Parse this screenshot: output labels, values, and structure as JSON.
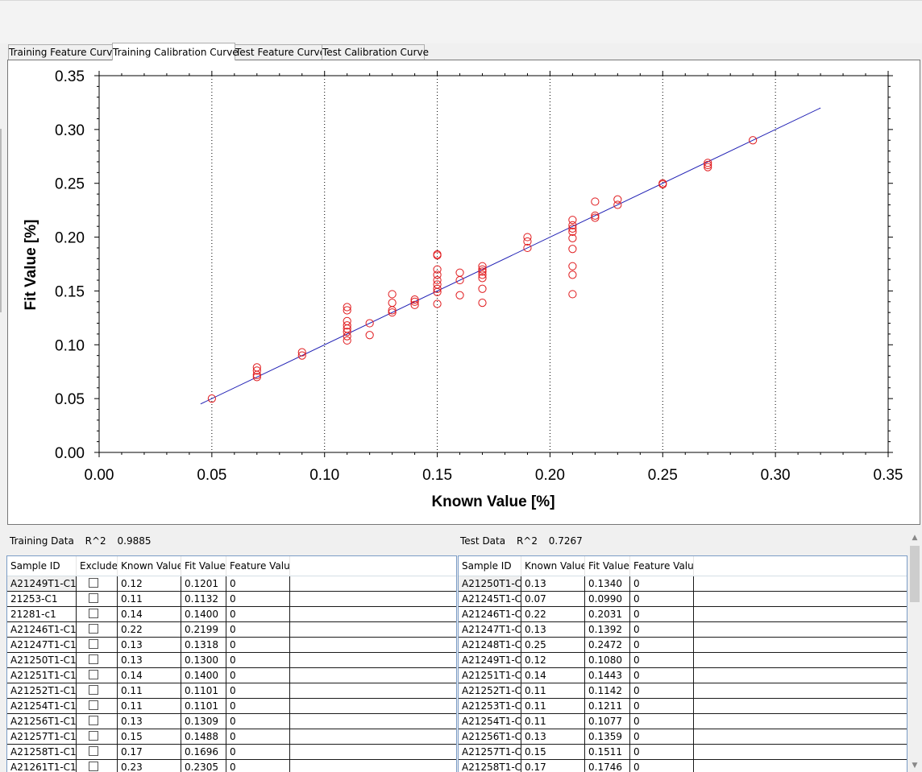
{
  "tabs": [
    "Training Feature Curve",
    "Training Calibration Curve",
    "Test Feature Curve",
    "Test Calibration Curve"
  ],
  "active_tab": 1,
  "chart_data": {
    "type": "scatter",
    "title": "",
    "xlabel": "Known Value [%]",
    "ylabel": "Fit Value [%]",
    "xlim": [
      0,
      0.35
    ],
    "ylim": [
      0,
      0.35
    ],
    "x_ticks": [
      "0.00",
      "0.05",
      "0.10",
      "0.15",
      "0.20",
      "0.25",
      "0.30",
      "0.35"
    ],
    "y_ticks": [
      "0.00",
      "0.05",
      "0.10",
      "0.15",
      "0.20",
      "0.25",
      "0.30",
      "0.35"
    ],
    "x_gridlines": "dotted vertical",
    "marker_color": "#e0191c",
    "line_color": "#1f1fb4",
    "fit_line": {
      "x": [
        0.045,
        0.32
      ],
      "y": [
        0.045,
        0.32
      ]
    },
    "points": [
      [
        0.05,
        0.05
      ],
      [
        0.07,
        0.07
      ],
      [
        0.07,
        0.072
      ],
      [
        0.07,
        0.076
      ],
      [
        0.07,
        0.079
      ],
      [
        0.09,
        0.09
      ],
      [
        0.09,
        0.093
      ],
      [
        0.11,
        0.104
      ],
      [
        0.11,
        0.108
      ],
      [
        0.11,
        0.112
      ],
      [
        0.11,
        0.115
      ],
      [
        0.11,
        0.118
      ],
      [
        0.11,
        0.122
      ],
      [
        0.11,
        0.132
      ],
      [
        0.11,
        0.135
      ],
      [
        0.12,
        0.109
      ],
      [
        0.12,
        0.12
      ],
      [
        0.13,
        0.13
      ],
      [
        0.13,
        0.132
      ],
      [
        0.13,
        0.139
      ],
      [
        0.13,
        0.147
      ],
      [
        0.14,
        0.137
      ],
      [
        0.14,
        0.14
      ],
      [
        0.14,
        0.142
      ],
      [
        0.15,
        0.138
      ],
      [
        0.15,
        0.149
      ],
      [
        0.15,
        0.152
      ],
      [
        0.15,
        0.156
      ],
      [
        0.15,
        0.16
      ],
      [
        0.15,
        0.165
      ],
      [
        0.15,
        0.17
      ],
      [
        0.15,
        0.183
      ],
      [
        0.15,
        0.184
      ],
      [
        0.16,
        0.146
      ],
      [
        0.16,
        0.16
      ],
      [
        0.16,
        0.167
      ],
      [
        0.17,
        0.139
      ],
      [
        0.17,
        0.152
      ],
      [
        0.17,
        0.162
      ],
      [
        0.17,
        0.165
      ],
      [
        0.17,
        0.168
      ],
      [
        0.17,
        0.17
      ],
      [
        0.17,
        0.173
      ],
      [
        0.19,
        0.19
      ],
      [
        0.19,
        0.196
      ],
      [
        0.19,
        0.2
      ],
      [
        0.21,
        0.147
      ],
      [
        0.21,
        0.165
      ],
      [
        0.21,
        0.173
      ],
      [
        0.21,
        0.189
      ],
      [
        0.21,
        0.199
      ],
      [
        0.21,
        0.205
      ],
      [
        0.21,
        0.208
      ],
      [
        0.21,
        0.211
      ],
      [
        0.21,
        0.216
      ],
      [
        0.22,
        0.218
      ],
      [
        0.22,
        0.22
      ],
      [
        0.22,
        0.233
      ],
      [
        0.23,
        0.23
      ],
      [
        0.23,
        0.235
      ],
      [
        0.25,
        0.249
      ],
      [
        0.25,
        0.25
      ],
      [
        0.27,
        0.265
      ],
      [
        0.27,
        0.267
      ],
      [
        0.27,
        0.269
      ],
      [
        0.29,
        0.29
      ]
    ]
  },
  "training": {
    "label": "Training Data",
    "r2_label": "R^2",
    "r2_value": "0.9885",
    "columns": [
      "Sample ID",
      "Exclude",
      "Known Value",
      "Fit Value",
      "Feature Value"
    ],
    "rows": [
      [
        "A21249T1-C1",
        "",
        "0.12",
        "0.1201",
        "0"
      ],
      [
        "21253-C1",
        "",
        "0.11",
        "0.1132",
        "0"
      ],
      [
        "21281-c1",
        "",
        "0.14",
        "0.1400",
        "0"
      ],
      [
        "A21246T1-C1",
        "",
        "0.22",
        "0.2199",
        "0"
      ],
      [
        "A21247T1-C1",
        "",
        "0.13",
        "0.1318",
        "0"
      ],
      [
        "A21250T1-C1",
        "",
        "0.13",
        "0.1300",
        "0"
      ],
      [
        "A21251T1-C1",
        "",
        "0.14",
        "0.1400",
        "0"
      ],
      [
        "A21252T1-C1",
        "",
        "0.11",
        "0.1101",
        "0"
      ],
      [
        "A21254T1-C1",
        "",
        "0.11",
        "0.1101",
        "0"
      ],
      [
        "A21256T1-C1",
        "",
        "0.13",
        "0.1309",
        "0"
      ],
      [
        "A21257T1-C1",
        "",
        "0.15",
        "0.1488",
        "0"
      ],
      [
        "A21258T1-C1",
        "",
        "0.17",
        "0.1696",
        "0"
      ],
      [
        "A21261T1-C1",
        "",
        "0.23",
        "0.2305",
        "0"
      ]
    ]
  },
  "test": {
    "label": "Test Data",
    "r2_label": "R^2",
    "r2_value": "0.7267",
    "columns": [
      "Sample ID",
      "Known Value",
      "Fit Value",
      "Feature Value"
    ],
    "rows": [
      [
        "A21250T1-C",
        "0.13",
        "0.1340",
        "0"
      ],
      [
        "A21245T1-C",
        "0.07",
        "0.0990",
        "0"
      ],
      [
        "A21246T1-C",
        "0.22",
        "0.2031",
        "0"
      ],
      [
        "A21247T1-C",
        "0.13",
        "0.1392",
        "0"
      ],
      [
        "A21248T1-C",
        "0.25",
        "0.2472",
        "0"
      ],
      [
        "A21249T1-C",
        "0.12",
        "0.1080",
        "0"
      ],
      [
        "A21251T1-C",
        "0.14",
        "0.1443",
        "0"
      ],
      [
        "A21252T1-C",
        "0.11",
        "0.1142",
        "0"
      ],
      [
        "A21253T1-C",
        "0.11",
        "0.1211",
        "0"
      ],
      [
        "A21254T1-C",
        "0.11",
        "0.1077",
        "0"
      ],
      [
        "A21256T1-C",
        "0.13",
        "0.1359",
        "0"
      ],
      [
        "A21257T1-C",
        "0.15",
        "0.1511",
        "0"
      ],
      [
        "A21258T1-C",
        "0.17",
        "0.1746",
        "0"
      ]
    ]
  }
}
